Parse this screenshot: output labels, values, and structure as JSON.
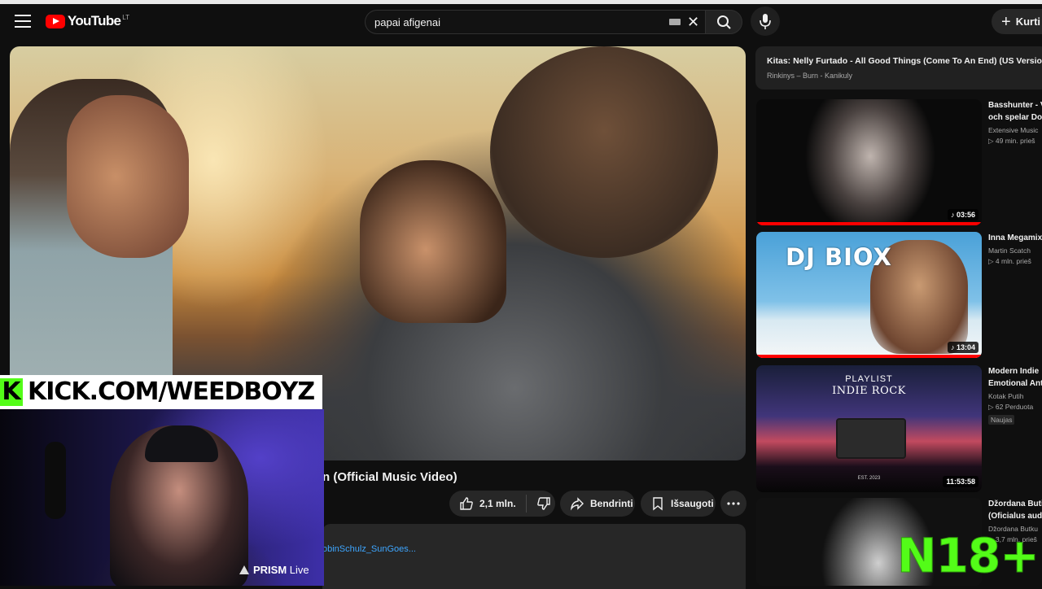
{
  "app": {
    "logo": "YouTube",
    "country_code": "LT"
  },
  "search": {
    "query": "papai afigenai"
  },
  "header": {
    "create_label": "Kurti"
  },
  "video": {
    "title_visible": "n (Official Music Video)",
    "likes": "2,1 mln.",
    "share_label": "Bendrinti",
    "save_label": "Išsaugoti",
    "description_link": "obinSchulz_SunGoes..."
  },
  "up_next": {
    "title": "Kitas: Nelly Furtado - All Good Things (Come To An End) (US Version) (",
    "subtitle": "Rinkinys – Burn - Kanikuly"
  },
  "sidebar": {
    "items": [
      {
        "title1": "Basshunter - V",
        "title2": "och spelar Do",
        "channel": "Extensive Music",
        "meta": "▷ 49 min.  prieš",
        "duration": "♪ 03:56"
      },
      {
        "title1": "Inna Megamix",
        "channel": "Martin Scatch",
        "meta": "▷ 4 mln.  prieš",
        "duration": "♪ 13:04",
        "thumb_text": "DJ BIOX"
      },
      {
        "title1": "Modern Indie",
        "title2": "Emotional Ant",
        "channel": "Kotak Putih",
        "meta": "▷ 62  Perduota",
        "badge": "Naujas",
        "duration": "11:53:58",
        "thumb_line1": "PLAYLIST",
        "thumb_line2": "INDIE ROCK",
        "thumb_small": "EST. 2023"
      },
      {
        "title1": "Džordana Buti",
        "title2": "(Oficialus aud",
        "channel": "Džordana Butku",
        "meta": "▷ 3,7 mln.  prieš"
      }
    ]
  },
  "overlay": {
    "kick_letter": "K",
    "kick_text": "KICK.COM/WEEDBOYZ",
    "prism_brand": "PRISM",
    "prism_live": "Live",
    "age_rating": "N18+"
  },
  "colors": {
    "background": "#0f0f0f",
    "accent": "#ff0000",
    "kick_green": "#53fc18",
    "link": "#3ea6ff"
  }
}
